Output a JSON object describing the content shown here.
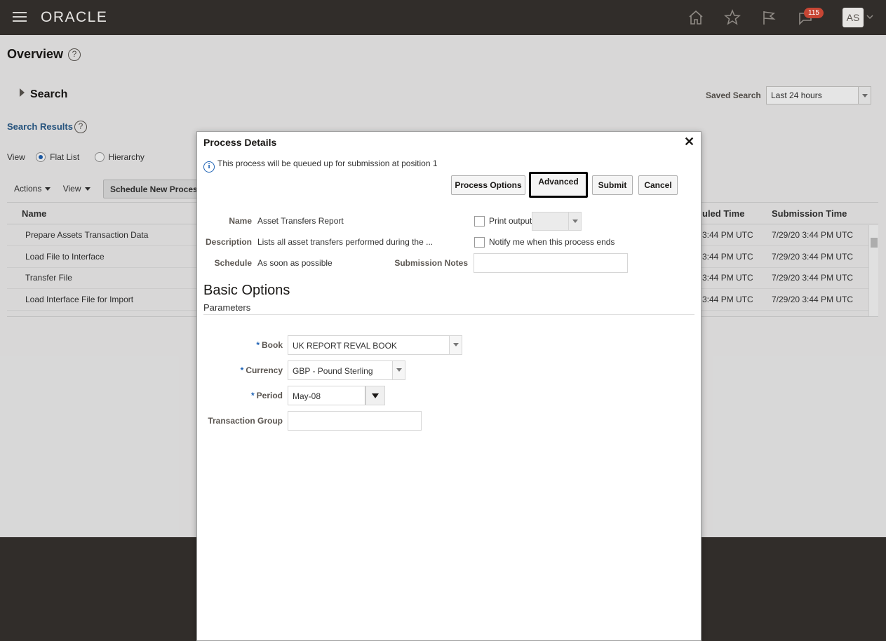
{
  "header": {
    "logo": "ORACLE",
    "notification_count": "115",
    "user_initials": "AS",
    "icons": [
      "menu-icon",
      "home-icon",
      "star-icon",
      "flag-icon",
      "notifications-icon"
    ]
  },
  "page": {
    "title": "Overview",
    "search_label": "Search",
    "saved_search_label": "Saved Search",
    "saved_search_value": "Last 24 hours",
    "search_results_label": "Search Results",
    "view_label": "View",
    "view_options": [
      "Flat List",
      "Hierarchy"
    ],
    "actions_label": "Actions",
    "view_menu_label": "View",
    "schedule_button": "Schedule New Process",
    "table": {
      "columns": [
        "Name",
        "uled Time",
        "Submission Time"
      ],
      "rows": [
        {
          "name": "Prepare Assets Transaction Data",
          "scheduled": "3:44 PM UTC",
          "submitted": "7/29/20 3:44 PM UTC"
        },
        {
          "name": "Load File to Interface",
          "scheduled": "3:44 PM UTC",
          "submitted": "7/29/20 3:44 PM UTC"
        },
        {
          "name": "Transfer File",
          "scheduled": "3:44 PM UTC",
          "submitted": "7/29/20 3:44 PM UTC"
        },
        {
          "name": "Load Interface File for Import",
          "scheduled": "3:44 PM UTC",
          "submitted": "7/29/20 3:44 PM UTC"
        }
      ]
    }
  },
  "dialog": {
    "title": "Process Details",
    "info_message": "This process will be queued up for submission at position 1",
    "buttons": {
      "process_options": "Process Options",
      "advanced": "Advanced",
      "submit": "Submit",
      "cancel": "Cancel"
    },
    "name_label": "Name",
    "name_value": "Asset Transfers Report",
    "description_label": "Description",
    "description_value": "Lists all asset transfers performed during the ...",
    "schedule_label": "Schedule",
    "schedule_value": "As soon as possible",
    "print_output_label": "Print output",
    "notify_label": "Notify me when this process ends",
    "submission_notes_label": "Submission Notes",
    "basic_options": "Basic Options",
    "parameters": "Parameters",
    "fields": {
      "book_label": "Book",
      "book_value": "UK REPORT REVAL BOOK",
      "currency_label": "Currency",
      "currency_value": "GBP - Pound Sterling",
      "period_label": "Period",
      "period_value": "May-08",
      "transaction_group_label": "Transaction Group",
      "transaction_group_value": ""
    }
  },
  "colors": {
    "header_bg": "#312d2a",
    "link_blue": "#2b5d8c",
    "badge_red": "#c74634"
  }
}
